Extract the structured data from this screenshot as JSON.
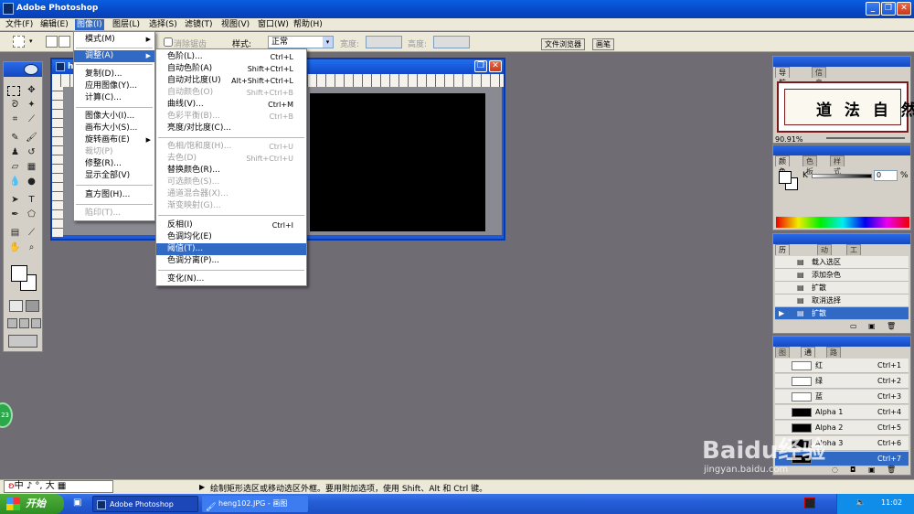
{
  "app": {
    "title": "Adobe Photoshop"
  },
  "menubar": [
    {
      "label": "文件(F)",
      "active": false
    },
    {
      "label": "编辑(E)",
      "active": false
    },
    {
      "label": "图像(I)",
      "active": true
    },
    {
      "label": "图层(L)",
      "active": false
    },
    {
      "label": "选择(S)",
      "active": false
    },
    {
      "label": "滤镜(T)",
      "active": false
    },
    {
      "label": "视图(V)",
      "active": false
    },
    {
      "label": "窗口(W)",
      "active": false
    },
    {
      "label": "帮助(H)",
      "active": false
    }
  ],
  "options": {
    "antialias_label": "消除锯齿",
    "style_label": "样式:",
    "style_value": "正常",
    "width_label": "宽度:",
    "height_label": "高度:",
    "file_browser_tab": "文件浏览器",
    "brush_tab": "画笔"
  },
  "document": {
    "title": "h"
  },
  "image_menu": [
    {
      "label": "模式(M)",
      "submenu": true
    },
    {
      "label": "调整(A)",
      "submenu": true,
      "selected": true
    },
    {
      "label": "复制(D)..."
    },
    {
      "label": "应用图像(Y)..."
    },
    {
      "label": "计算(C)..."
    },
    {
      "label": "图像大小(I)..."
    },
    {
      "label": "画布大小(S)..."
    },
    {
      "label": "旋转画布(E)",
      "submenu": true
    },
    {
      "label": "裁切(P)",
      "disabled": true
    },
    {
      "label": "修整(R)..."
    },
    {
      "label": "显示全部(V)"
    },
    {
      "label": "直方图(H)..."
    },
    {
      "label": "陷印(T)...",
      "disabled": true
    }
  ],
  "adjust_menu": [
    {
      "label": "色阶(L)...",
      "shortcut": "Ctrl+L"
    },
    {
      "label": "自动色阶(A)",
      "shortcut": "Shift+Ctrl+L"
    },
    {
      "label": "自动对比度(U)",
      "shortcut": "Alt+Shift+Ctrl+L"
    },
    {
      "label": "自动颜色(O)",
      "shortcut": "Shift+Ctrl+B",
      "disabled": true
    },
    {
      "label": "曲线(V)...",
      "shortcut": "Ctrl+M"
    },
    {
      "label": "色彩平衡(B)...",
      "shortcut": "Ctrl+B",
      "disabled": true
    },
    {
      "label": "亮度/对比度(C)..."
    },
    {
      "label": "色相/饱和度(H)...",
      "shortcut": "Ctrl+U",
      "disabled": true
    },
    {
      "label": "去色(D)",
      "shortcut": "Shift+Ctrl+U",
      "disabled": true
    },
    {
      "label": "替换颜色(R)..."
    },
    {
      "label": "可选颜色(S)...",
      "disabled": true
    },
    {
      "label": "通道混合器(X)...",
      "disabled": true
    },
    {
      "label": "渐变映射(G)...",
      "disabled": true
    },
    {
      "label": "反相(I)",
      "shortcut": "Ctrl+I"
    },
    {
      "label": "色调均化(E)"
    },
    {
      "label": "阈值(T)...",
      "selected": true
    },
    {
      "label": "色调分离(P)..."
    },
    {
      "label": "变化(N)..."
    }
  ],
  "navigator": {
    "tab1": "导航器",
    "tab2": "信息",
    "zoom": "90.91%",
    "artwork": "道 法 自 然"
  },
  "color": {
    "tab1": "颜色",
    "tab2": "色板",
    "tab3": "样式",
    "channel_label": "K",
    "value": "0",
    "unit": "%"
  },
  "history": {
    "tab1": "历史记录",
    "tab2": "动作",
    "tab3": "工具预设",
    "items": [
      {
        "label": "载入选区",
        "selected": false
      },
      {
        "label": "添加杂色",
        "selected": false
      },
      {
        "label": "扩散",
        "selected": false
      },
      {
        "label": "取消选择",
        "selected": false
      },
      {
        "label": "扩散",
        "selected": true
      }
    ]
  },
  "channels": {
    "tab1": "图层",
    "tab2": "通道",
    "tab3": "路径",
    "items": [
      {
        "name": "红",
        "shortcut": "Ctrl+1",
        "selected": false
      },
      {
        "name": "绿",
        "shortcut": "Ctrl+2",
        "selected": false
      },
      {
        "name": "蓝",
        "shortcut": "Ctrl+3",
        "selected": false
      },
      {
        "name": "Alpha 1",
        "shortcut": "Ctrl+4",
        "selected": false
      },
      {
        "name": "Alpha 2",
        "shortcut": "Ctrl+5",
        "selected": false
      },
      {
        "name": "Alpha 3",
        "shortcut": "Ctrl+6",
        "selected": false
      },
      {
        "name": "",
        "shortcut": "Ctrl+7",
        "selected": true
      }
    ]
  },
  "status": {
    "message": "绘制矩形选区或移动选区外框。要用附加选项，使用 Shift、Alt 和 Ctrl 键。",
    "ime": "中 ♪ °, 大"
  },
  "taskbar": {
    "start": "开始",
    "tasks": [
      "Adobe Photoshop",
      "heng102.JPG - 画图"
    ],
    "clock": "11:02"
  },
  "watermark": {
    "brand": "Baidu经验",
    "url": "jingyan.baidu.com"
  },
  "badge": "23"
}
